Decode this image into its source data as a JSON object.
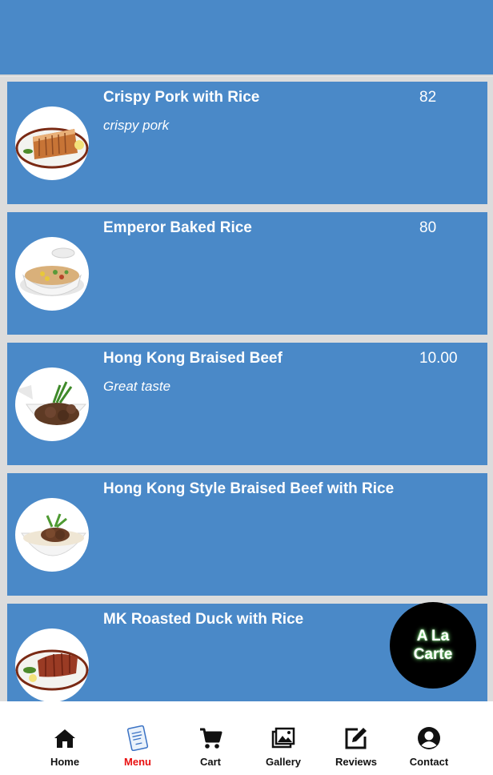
{
  "colors": {
    "header": "#4a89c8",
    "item_bg": "#4a89c8",
    "active_nav": "#e81010",
    "fab_bg": "#000000"
  },
  "menu": {
    "items": [
      {
        "name": "Crispy Pork with Rice",
        "description": "crispy pork",
        "price": "82",
        "image": "crispy-pork-dish"
      },
      {
        "name": "Emperor Baked Rice",
        "description": "",
        "price": "80",
        "image": "baked-rice-dish"
      },
      {
        "name": "Hong Kong Braised Beef",
        "description": "Great taste",
        "price": "10.00",
        "image": "braised-beef-dish"
      },
      {
        "name": "Hong Kong Style Braised Beef with Rice",
        "description": "",
        "price": "",
        "image": "beef-rice-dish"
      },
      {
        "name": "MK Roasted Duck with Rice",
        "description": "",
        "price": "",
        "image": "roasted-duck-dish"
      }
    ]
  },
  "fab": {
    "line1": "A La",
    "line2": "Carte"
  },
  "nav": {
    "items": [
      {
        "label": "Home",
        "icon": "home-icon",
        "active": false
      },
      {
        "label": "Menu",
        "icon": "menu-book-icon",
        "active": true
      },
      {
        "label": "Cart",
        "icon": "cart-icon",
        "active": false
      },
      {
        "label": "Gallery",
        "icon": "gallery-icon",
        "active": false
      },
      {
        "label": "Reviews",
        "icon": "edit-icon",
        "active": false
      },
      {
        "label": "Contact",
        "icon": "user-icon",
        "active": false
      }
    ]
  }
}
